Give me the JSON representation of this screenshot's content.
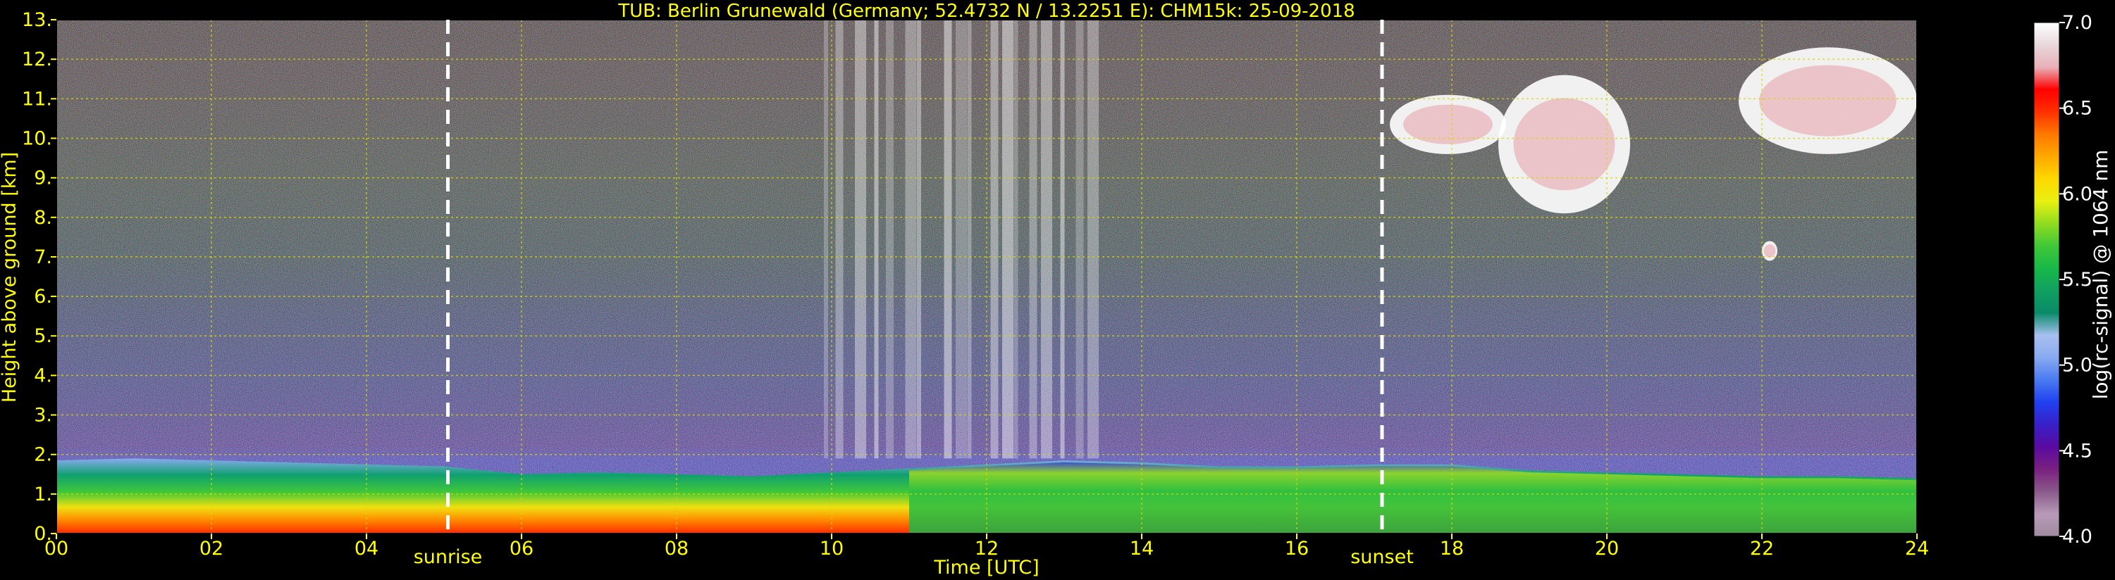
{
  "title": "TUB: Berlin Grunewald (Germany; 52.4732 N / 13.2251 E):    CHM15k: 25-09-2018",
  "chart_data": {
    "type": "heatmap",
    "title": "TUB: Berlin Grunewald (Germany; 52.4732 N / 13.2251 E):    CHM15k: 25-09-2018",
    "xlabel": "Time [UTC]",
    "ylabel": "Height above ground [km]",
    "xlim": [
      0,
      24
    ],
    "ylim": [
      0,
      13
    ],
    "x_ticks": [
      0,
      2,
      4,
      6,
      8,
      10,
      12,
      14,
      16,
      18,
      20,
      22,
      24
    ],
    "x_tick_labels": [
      "00",
      "02",
      "04",
      "06",
      "08",
      "10",
      "12",
      "14",
      "16",
      "18",
      "20",
      "22",
      "24"
    ],
    "y_ticks": [
      0,
      1,
      2,
      3,
      4,
      5,
      6,
      7,
      8,
      9,
      10,
      11,
      12,
      13
    ],
    "y_tick_labels": [
      "0.",
      "1.",
      "2.",
      "3.",
      "4.",
      "5.",
      "6.",
      "7.",
      "8.",
      "9.",
      "10.",
      "11.",
      "12.",
      "13."
    ],
    "grid": true,
    "annotations": [
      {
        "text": "sunrise",
        "x": 5.05
      },
      {
        "text": "sunset",
        "x": 17.1
      }
    ],
    "colorbar": {
      "label": "log(rc-signal) @ 1064 nm",
      "range": [
        4.0,
        7.0
      ],
      "ticks": [
        4.0,
        4.5,
        5.0,
        5.5,
        6.0,
        6.5,
        7.0
      ],
      "tick_labels": [
        "4.0",
        "4.5",
        "5.0",
        "5.5",
        "6.0",
        "6.5",
        "7.0"
      ],
      "colors": [
        "#a08ca0",
        "#b89ab8",
        "#8a5a8a",
        "#7a2080",
        "#5a0aa0",
        "#3820c8",
        "#2040f0",
        "#4a7af0",
        "#88aaf0",
        "#a8c0f0",
        "#0a8a6a",
        "#10a060",
        "#18b848",
        "#40c838",
        "#90dc20",
        "#e8f010",
        "#ffd800",
        "#ffa800",
        "#ff7800",
        "#ff3000",
        "#ff0000",
        "#e8b0b8",
        "#e8d8dc",
        "#ffffff"
      ]
    },
    "boundary_layer_top_km": {
      "x": [
        0,
        1,
        2,
        3,
        4,
        5,
        6,
        7,
        8,
        9,
        10,
        11,
        12,
        13,
        14,
        15,
        16,
        17,
        18,
        19,
        20,
        21,
        22,
        23,
        24
      ],
      "y": [
        1.85,
        1.9,
        1.85,
        1.8,
        1.75,
        1.7,
        1.5,
        1.55,
        1.5,
        1.45,
        1.55,
        1.65,
        1.75,
        1.85,
        1.8,
        1.7,
        1.7,
        1.75,
        1.75,
        1.6,
        1.55,
        1.5,
        1.45,
        1.45,
        1.4
      ]
    },
    "clouds_km": [
      {
        "x": [
          17.2,
          18.7
        ],
        "y": [
          9.6,
          11.1
        ]
      },
      {
        "x": [
          18.6,
          20.3
        ],
        "y": [
          8.1,
          11.6
        ]
      },
      {
        "x": [
          21.7,
          24.0
        ],
        "y": [
          9.6,
          12.3
        ]
      },
      {
        "x": [
          22.0,
          22.2
        ],
        "y": [
          6.9,
          7.4
        ]
      }
    ]
  }
}
